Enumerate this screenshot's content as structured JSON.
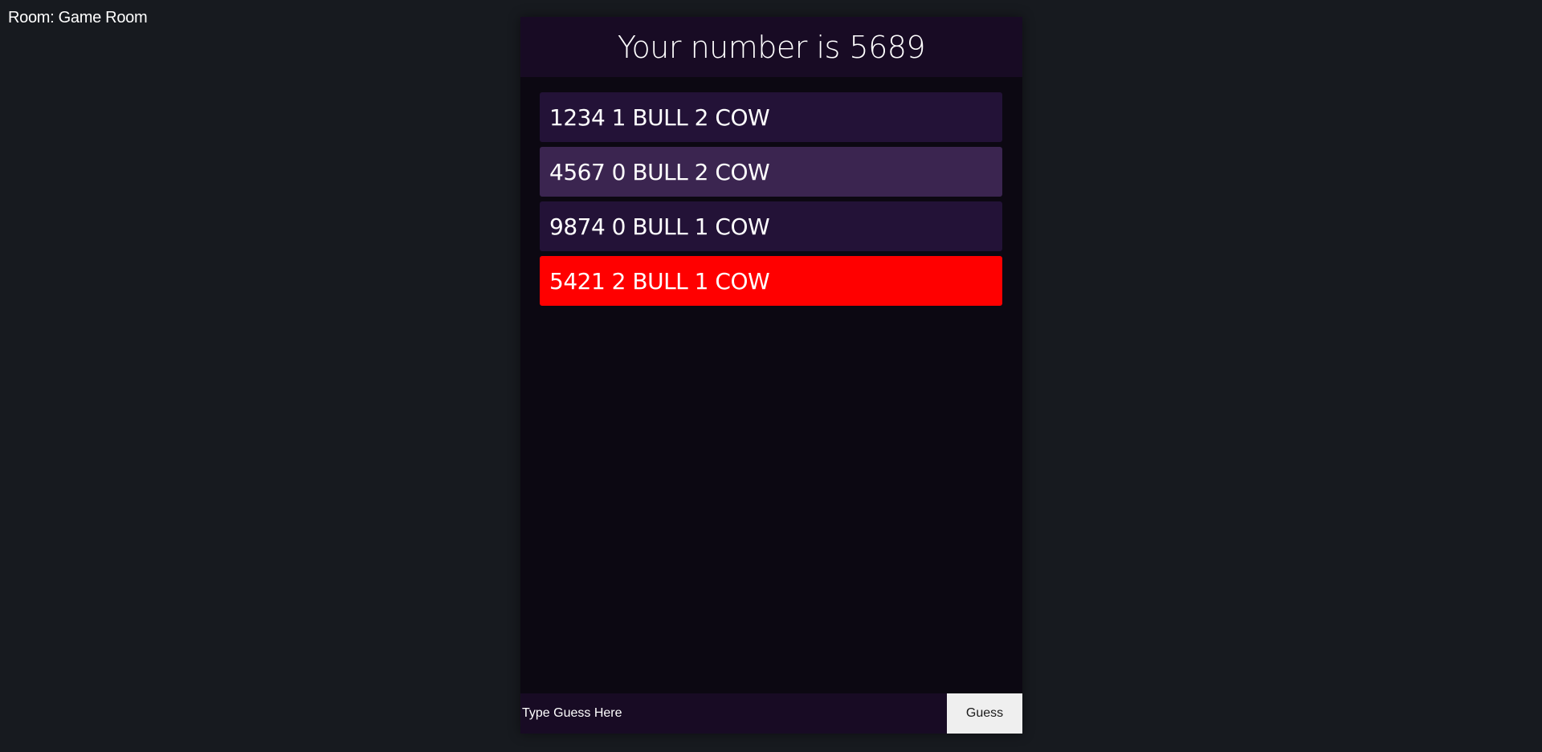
{
  "room": {
    "label": "Room: Game Room"
  },
  "header": {
    "title": "Your number is 5689"
  },
  "guesses": [
    {
      "text": "1234 1 BULL 2 COW",
      "bg": "#231237"
    },
    {
      "text": "4567 0 BULL 2 COW",
      "bg": "#3b2550"
    },
    {
      "text": "9874 0 BULL 1 COW",
      "bg": "#231237"
    },
    {
      "text": "5421 2 BULL 1 COW",
      "bg": "#ff0000"
    }
  ],
  "input": {
    "placeholder": "Type Guess Here",
    "value": ""
  },
  "button": {
    "label": "Guess"
  },
  "colors": {
    "page_bg": "#171a1f",
    "panel_bg": "#0c0812",
    "header_bg": "#180b24",
    "highlight": "#ff0000"
  }
}
